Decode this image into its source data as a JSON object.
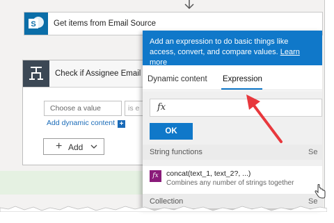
{
  "sharepoint_step": {
    "title": "Get items from Email Source",
    "icon": "sharepoint-icon"
  },
  "condition": {
    "title": "Check if Assignee Email Ac",
    "icon": "condition-icon",
    "choose_placeholder": "Choose a value",
    "operator": "is e",
    "add_dynamic_label": "Add dynamic content",
    "add_button_label": "Add"
  },
  "expression_panel": {
    "tip_text": "Add an expression to do basic things like access, convert, and compare values.",
    "tip_link": "Learn more",
    "tabs": [
      {
        "label": "Dynamic content",
        "active": false
      },
      {
        "label": "Expression",
        "active": true
      }
    ],
    "fx_symbol": "fx",
    "ok_label": "OK",
    "sections": [
      {
        "title": "String functions",
        "see_more": "Se"
      },
      {
        "title": "Collection",
        "see_more": "Se"
      }
    ],
    "functions": [
      {
        "name": "concat(text_1, text_2?, ...)",
        "description": "Combines any number of strings together",
        "icon_text": "fx"
      }
    ]
  },
  "colors": {
    "accent": "#1078c9",
    "function_icon": "#8a1b7a",
    "annotation_arrow": "#e8383d",
    "condition_header": "#3c4855"
  }
}
